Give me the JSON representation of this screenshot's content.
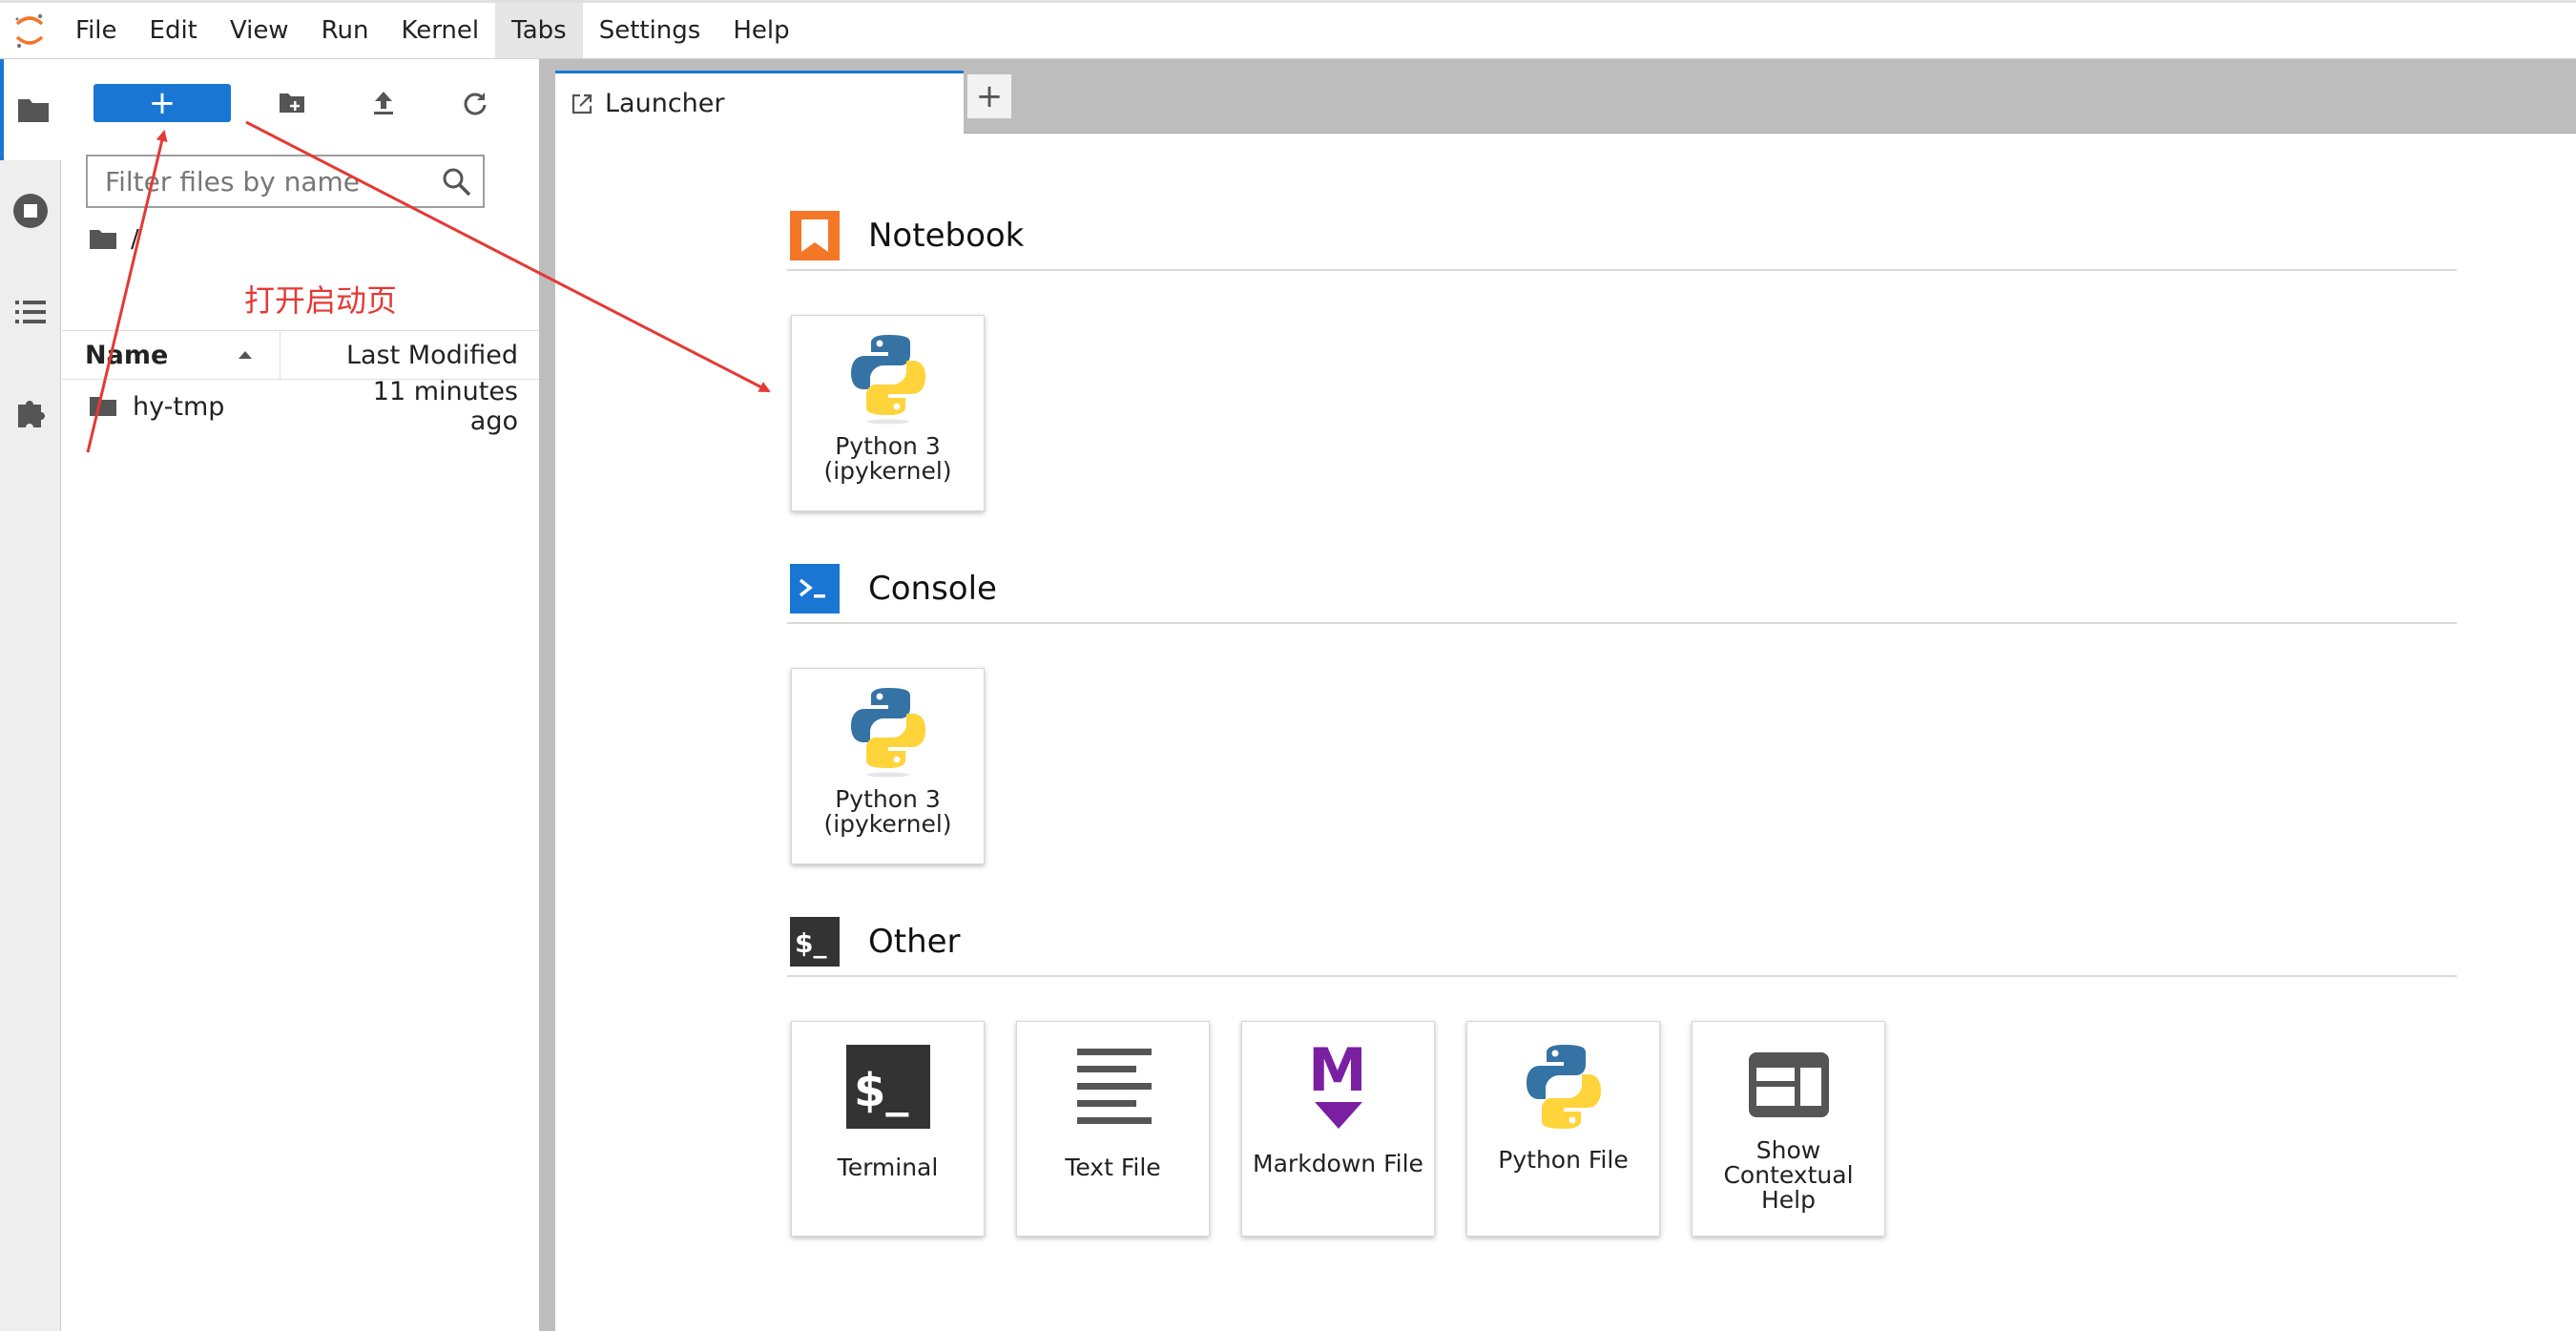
{
  "menubar": {
    "items": [
      "File",
      "Edit",
      "View",
      "Run",
      "Kernel",
      "Tabs",
      "Settings",
      "Help"
    ]
  },
  "filebrowser": {
    "new_button_label": "+",
    "filter_placeholder": "Filter files by name",
    "breadcrumb": "/",
    "annotation": "打开启动页",
    "columns": {
      "name": "Name",
      "modified": "Last Modified"
    },
    "files": [
      {
        "name": "hy-tmp",
        "modified": "11 minutes ago"
      }
    ]
  },
  "tabs": {
    "launcher_label": "Launcher",
    "add_label": "+"
  },
  "launcher": {
    "notebook": {
      "title": "Notebook",
      "cards": [
        {
          "label": "Python 3\n(ipykernel)"
        }
      ]
    },
    "console": {
      "title": "Console",
      "cards": [
        {
          "label": "Python 3\n(ipykernel)"
        }
      ]
    },
    "other": {
      "title": "Other",
      "cards": [
        {
          "label": "Terminal"
        },
        {
          "label": "Text File"
        },
        {
          "label": "Markdown File"
        },
        {
          "label": "Python File"
        },
        {
          "label": "Show\nContextual\nHelp"
        }
      ]
    }
  },
  "colors": {
    "accent": "#1976d2",
    "notebook_orange": "#f37726",
    "annotation_red": "#e53935"
  }
}
